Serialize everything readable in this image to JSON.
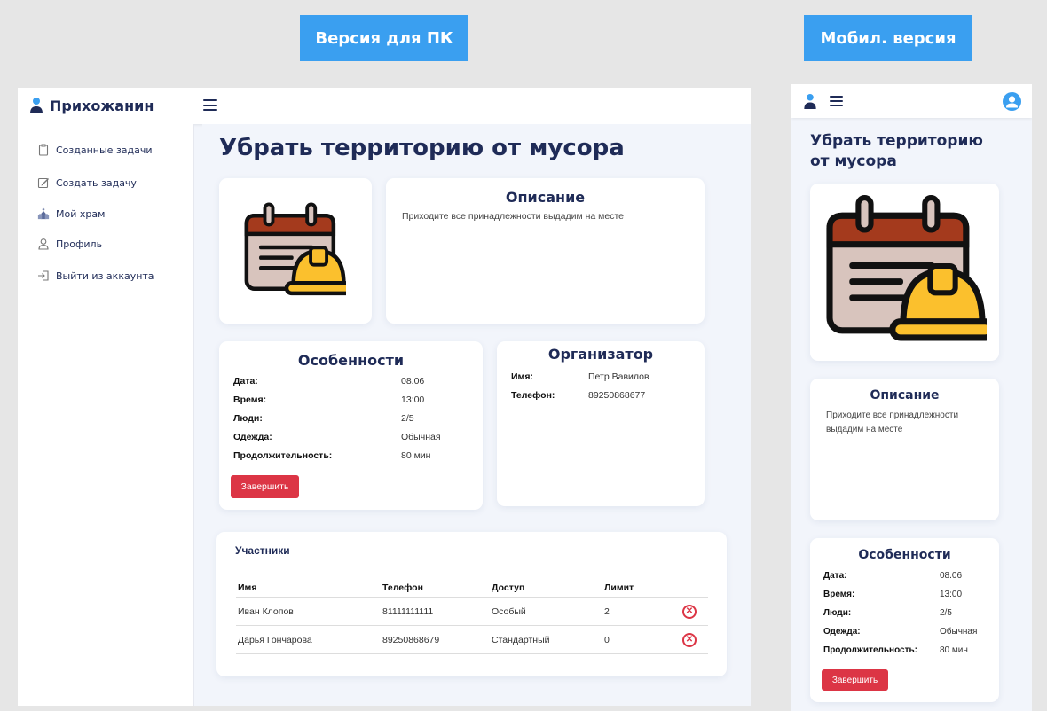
{
  "labels": {
    "pc": "Версия для ПК",
    "mobile": "Мобил. версия"
  },
  "brand": {
    "name": "Прихожанин"
  },
  "sidebar": {
    "items": [
      {
        "label": "Созданные задачи",
        "icon": "clipboard-icon"
      },
      {
        "label": "Создать задачу",
        "icon": "edit-icon"
      },
      {
        "label": "Мой храм",
        "icon": "church-icon"
      },
      {
        "label": "Профиль",
        "icon": "user-icon"
      },
      {
        "label": "Выйти из аккаунта",
        "icon": "logout-icon"
      }
    ]
  },
  "task": {
    "title": "Убрать территорию от мусора",
    "description_title": "Описание",
    "description": "Приходите все принадлежности выдадим на месте",
    "features_title": "Особенности",
    "features": [
      {
        "k": "Дата:",
        "v": "08.06"
      },
      {
        "k": "Время:",
        "v": "13:00"
      },
      {
        "k": "Люди:",
        "v": "2/5"
      },
      {
        "k": "Одежда:",
        "v": "Обычная"
      },
      {
        "k": "Продолжительность:",
        "v": "80 мин"
      }
    ],
    "finish_button": "Завершить",
    "organizer_title": "Организатор",
    "organizer": [
      {
        "k": "Имя:",
        "v": "Петр Вавилов"
      },
      {
        "k": "Телефон:",
        "v": "89250868677"
      }
    ]
  },
  "participants": {
    "title": "Участники",
    "columns": [
      "Имя",
      "Телефон",
      "Доступ",
      "Лимит"
    ],
    "rows": [
      {
        "name": "Иван Клопов",
        "phone": "81111111111",
        "access": "Особый",
        "limit": "2"
      },
      {
        "name": "Дарья Гончарова",
        "phone": "89250868679",
        "access": "Стандартный",
        "limit": "0"
      }
    ]
  },
  "mobile": {
    "title_line1": "Убрать территорию",
    "title_line2": "от мусора",
    "description_line1": "Приходите все принадлежности",
    "description_line2": "выдадим на месте"
  },
  "colors": {
    "accent": "#3a9ff0",
    "brand": "#1f2b57",
    "danger": "#dc3545"
  }
}
